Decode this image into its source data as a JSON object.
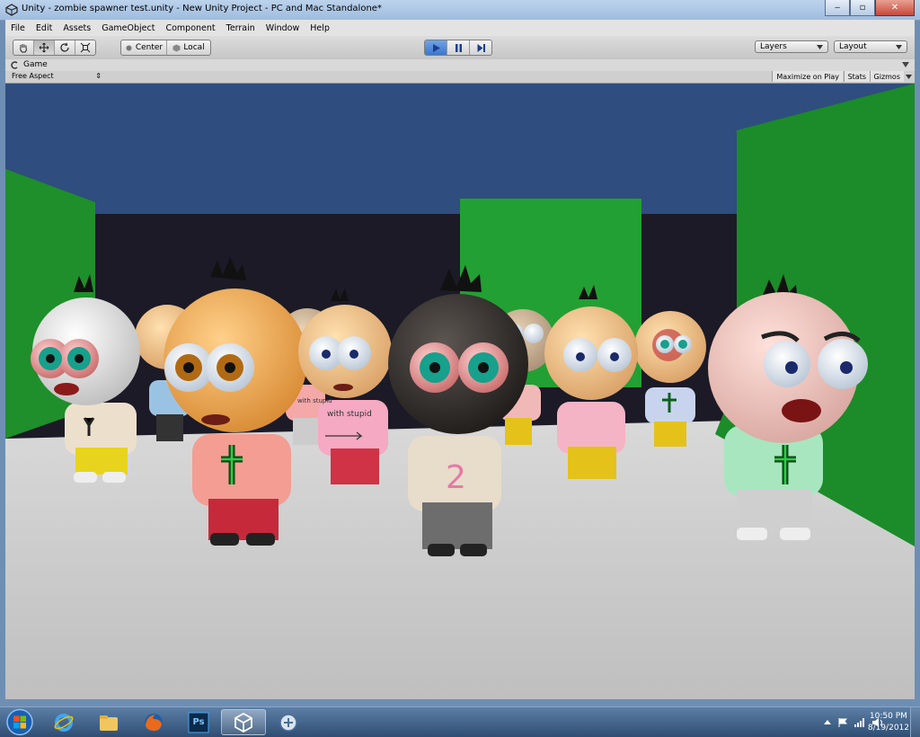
{
  "window": {
    "title": "Unity - zombie spawner test.unity - New Unity Project - PC and Mac Standalone*",
    "minimize_glyph": "‒",
    "maximize_glyph": "▫",
    "close_glyph": "✕"
  },
  "menu": [
    "File",
    "Edit",
    "Assets",
    "GameObject",
    "Component",
    "Terrain",
    "Window",
    "Help"
  ],
  "toolbar": {
    "transform_tools": [
      "hand-icon",
      "move-icon",
      "rotate-icon",
      "scale-icon"
    ],
    "pivot_label": "Center",
    "space_label": "Local",
    "playback": [
      "play-icon",
      "pause-icon",
      "step-icon"
    ],
    "layers_label": "Layers",
    "layout_label": "Layout"
  },
  "game_view": {
    "tab_label": "Game",
    "aspect_label": "Free Aspect",
    "maximize_on_play_label": "Maximize on Play",
    "stats_label": "Stats",
    "gizmos_label": "Gizmos"
  },
  "scene_text": {
    "shirt_label_1": "with stupid",
    "shirt_label_2": "with stupid",
    "shirt_number": "2"
  },
  "taskbar": {
    "apps": [
      {
        "name": "ie-icon",
        "active": false
      },
      {
        "name": "explorer-icon",
        "active": false
      },
      {
        "name": "firefox-icon",
        "active": false
      },
      {
        "name": "photoshop-icon",
        "active": false,
        "label": "Ps"
      },
      {
        "name": "unity-icon",
        "active": true
      },
      {
        "name": "app-icon",
        "active": false
      }
    ],
    "clock_time": "10:50 PM",
    "clock_date": "8/19/2012"
  },
  "colors": {
    "sky": "#2f4d7f",
    "back_wall": "#1b1a26",
    "floor": "#c9c9c9",
    "green_wall": "#1e8f2a",
    "play_button": "#4f8fe0"
  }
}
